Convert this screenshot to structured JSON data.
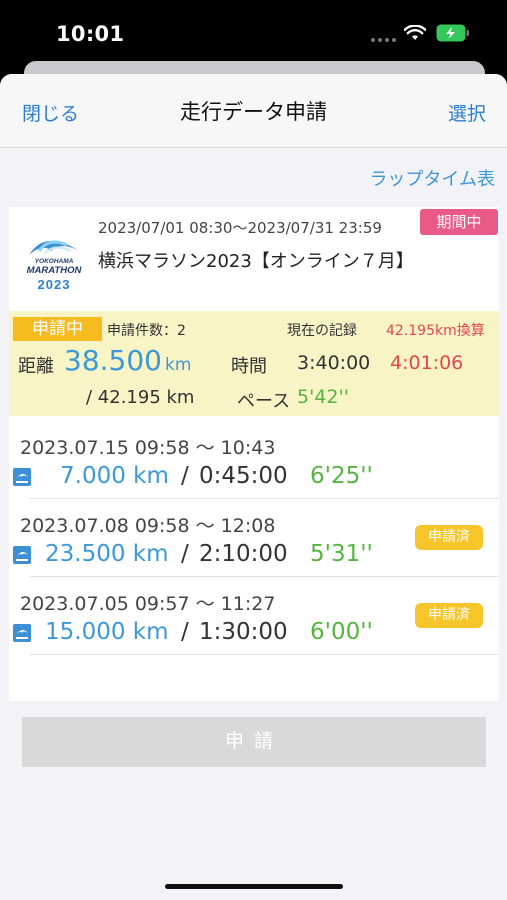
{
  "status": {
    "time": "10:01"
  },
  "nav": {
    "close": "閉じる",
    "title": "走行データ申請",
    "select": "選択"
  },
  "lap_link": "ラップタイム表",
  "event": {
    "period": "2023/07/01 08:30〜2023/07/31 23:59",
    "period_badge": "期間中",
    "name": "横浜マラソン2023【オンライン７月】",
    "logo_line1": "YOKOHAMA",
    "logo_line2": "MARATHON",
    "logo_year": "2023"
  },
  "summary": {
    "status_badge": "申請中",
    "count_label": "申請件数：2",
    "record_label": "現在の記録",
    "converted_label": "42.195km換算",
    "dist_label": "距離",
    "dist_value": "38.500",
    "dist_unit": "km",
    "time_label": "時間",
    "time_value": "3:40:00",
    "converted_value": "4:01:06",
    "target_value": "/ 42.195 km",
    "pace_label": "ペース",
    "pace_value": "5'42''"
  },
  "runs": [
    {
      "datetime": "2023.07.15   09:58  ～  10:43",
      "dist": "7.000 km",
      "sep": "/",
      "time": "0:45:00",
      "pace": "6'25''",
      "badge": ""
    },
    {
      "datetime": "2023.07.08   09:58  ～  12:08",
      "dist": "23.500 km",
      "sep": "/",
      "time": "2:10:00",
      "pace": "5'31''",
      "badge": "申請済"
    },
    {
      "datetime": "2023.07.05   09:57  ～  11:27",
      "dist": "15.000 km",
      "sep": "/",
      "time": "1:30:00",
      "pace": "6'00''",
      "badge": "申請済"
    }
  ],
  "submit_label": "申請",
  "colors": {
    "accent_blue": "#3c99d9",
    "pace_green": "#55b540",
    "alert_red": "#e3474e",
    "badge_pink": "#ea5a87",
    "badge_yellow": "#f6bb1f",
    "summary_bg": "#f8f4c6"
  }
}
